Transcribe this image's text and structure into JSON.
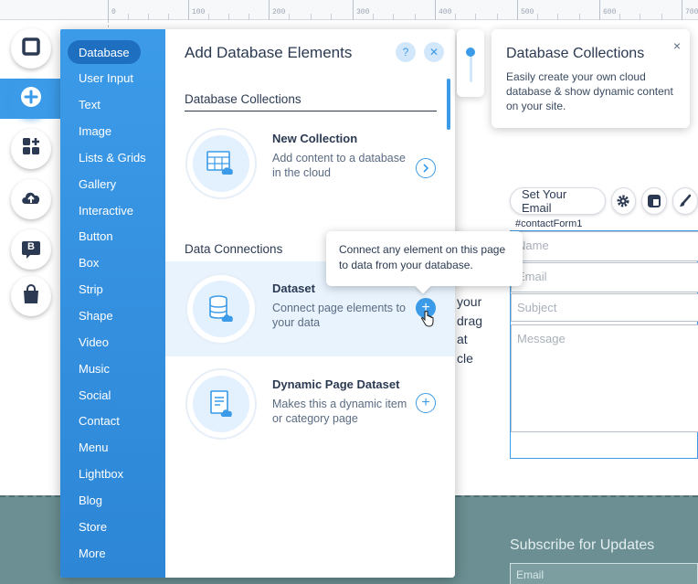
{
  "ruler": {
    "ticks": [
      "0",
      "100",
      "200",
      "300",
      "400",
      "500",
      "600",
      "700"
    ]
  },
  "panel": {
    "title": "Add Database Elements",
    "help_icon": "question-icon",
    "close_icon": "close-icon",
    "categories": [
      {
        "label": "Database",
        "selected": true
      },
      {
        "label": "User Input"
      },
      {
        "label": "Text"
      },
      {
        "label": "Image"
      },
      {
        "label": "Lists & Grids"
      },
      {
        "label": "Gallery"
      },
      {
        "label": "Interactive"
      },
      {
        "label": "Button"
      },
      {
        "label": "Box"
      },
      {
        "label": "Strip"
      },
      {
        "label": "Shape"
      },
      {
        "label": "Video"
      },
      {
        "label": "Music"
      },
      {
        "label": "Social"
      },
      {
        "label": "Contact"
      },
      {
        "label": "Menu"
      },
      {
        "label": "Lightbox"
      },
      {
        "label": "Blog"
      },
      {
        "label": "Store"
      },
      {
        "label": "More"
      }
    ],
    "sections": [
      {
        "heading": "Database Collections"
      },
      {
        "heading": "Data Connections"
      }
    ],
    "items": [
      {
        "title": "New Collection",
        "desc": "Add content to a database in the cloud",
        "action": "arrow"
      },
      {
        "title": "Dataset",
        "desc": "Connect page elements to your data",
        "action": "add"
      },
      {
        "title": "Dynamic Page Dataset",
        "desc": "Makes this a dynamic item or category page",
        "action": "add"
      }
    ]
  },
  "rail": {
    "buttons": [
      "square-icon",
      "plus-icon",
      "apps-icon",
      "upload-icon",
      "blog-icon",
      "bag-icon"
    ],
    "blog_letter": "B"
  },
  "tooltips": {
    "connect": "Connect any element on this page to data from your database.",
    "collections_title": "Database Collections",
    "collections_text": "Easily create your own cloud database & show dynamic content on your site.",
    "collections_close": "×"
  },
  "canvas": {
    "set_email": "Set Your Email",
    "form_id": "#contactForm1",
    "fields": [
      "Name",
      "Email",
      "Subject",
      "Message"
    ],
    "body_text": [
      "your",
      "drag",
      "at",
      "cle"
    ],
    "subscribe": "Subscribe for Updates",
    "sub_email": "Email"
  },
  "colors": {
    "accent": "#3b9be8",
    "footer": "#6b8f92",
    "text": "#2b3a52"
  }
}
